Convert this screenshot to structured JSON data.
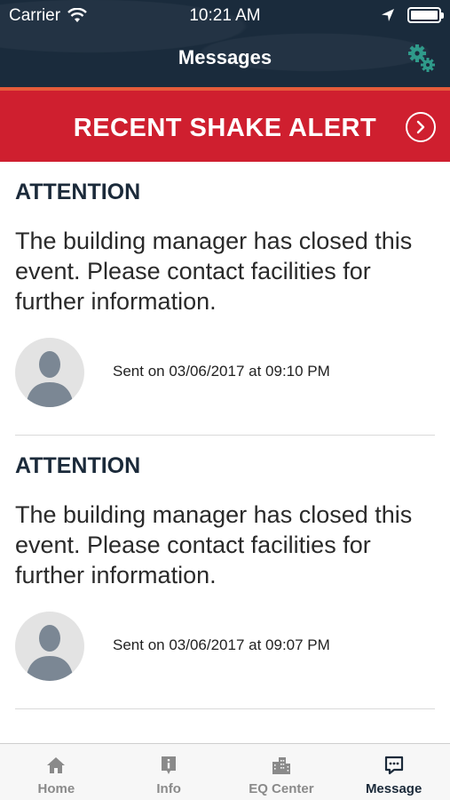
{
  "status_bar": {
    "carrier": "Carrier",
    "time": "10:21 AM"
  },
  "header": {
    "title": "Messages"
  },
  "alert_banner": {
    "label": "RECENT SHAKE ALERT"
  },
  "messages": [
    {
      "title": "ATTENTION",
      "body": "The building manager has closed this event. Please contact facilities for further information.",
      "sent": "Sent on 03/06/2017 at 09:10 PM"
    },
    {
      "title": "ATTENTION",
      "body": "The building manager has closed this event. Please contact facilities for further information.",
      "sent": "Sent on 03/06/2017 at 09:07 PM"
    }
  ],
  "tabs": [
    {
      "label": "Home",
      "icon": "home-icon",
      "active": false
    },
    {
      "label": "Info",
      "icon": "info-icon",
      "active": false
    },
    {
      "label": "EQ Center",
      "icon": "buildings-icon",
      "active": false
    },
    {
      "label": "Message",
      "icon": "message-icon",
      "active": true
    }
  ],
  "colors": {
    "header_bg": "#1a2b3c",
    "alert_red": "#cf1f2f",
    "settings_teal": "#2f9a8a",
    "active_tab": "#1b2a3a",
    "inactive_tab": "#8a8a8a"
  }
}
